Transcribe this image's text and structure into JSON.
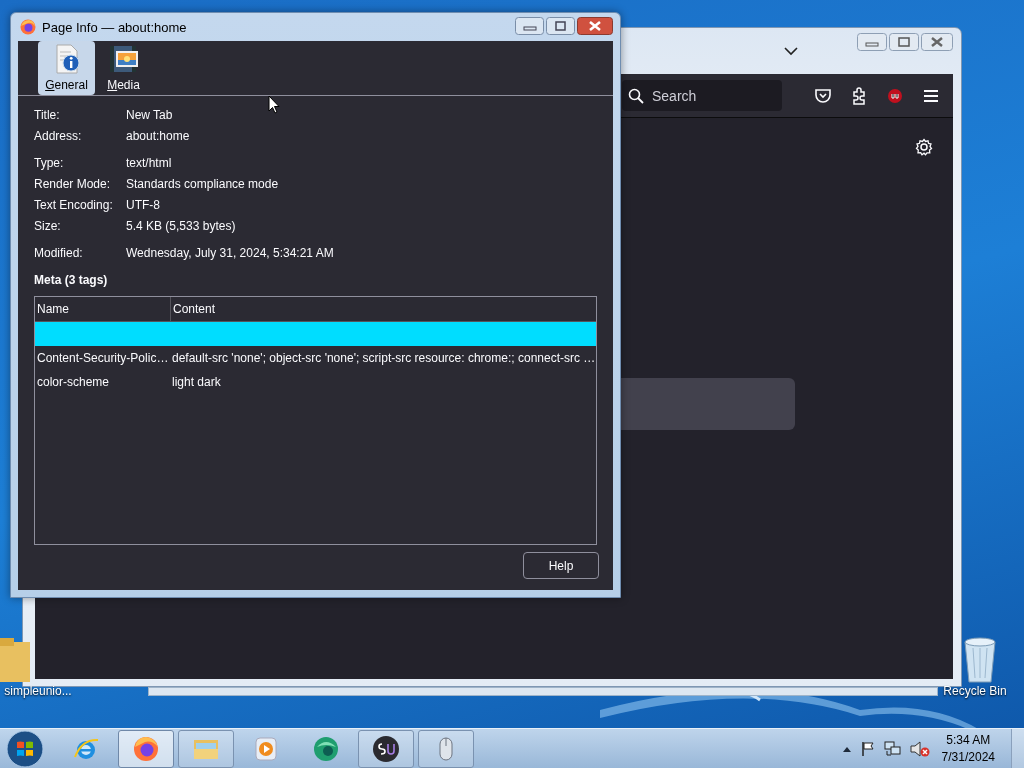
{
  "desktop": {
    "icons": [
      {
        "kind": "folder",
        "label": "simpleunio..."
      },
      {
        "kind": "recycle-bin",
        "label": "Recycle Bin"
      }
    ]
  },
  "browser": {
    "search": {
      "placeholder": "Search"
    }
  },
  "dialog": {
    "title": "Page Info — about:home",
    "tabs": [
      {
        "label": "General",
        "selected": true
      },
      {
        "label": "Media",
        "selected": false
      }
    ],
    "field_groups": [
      [
        {
          "label": "Title:",
          "value": "New Tab"
        },
        {
          "label": "Address:",
          "value": "about:home"
        }
      ],
      [
        {
          "label": "Type:",
          "value": "text/html"
        },
        {
          "label": "Render Mode:",
          "value": "Standards compliance mode"
        },
        {
          "label": "Text Encoding:",
          "value": "UTF-8"
        },
        {
          "label": "Size:",
          "value": "5.4 KB (5,533 bytes)"
        }
      ],
      [
        {
          "label": "Modified:",
          "value": "Wednesday, July 31, 2024, 5:34:21 AM"
        }
      ]
    ],
    "meta": {
      "heading": "Meta (3 tags)",
      "columns": [
        "Name",
        "Content"
      ],
      "rows": [
        {
          "selected": true
        },
        {
          "name": "Content-Security-Polic…",
          "content": "default-src 'none'; object-src 'none'; script-src resource: chrome:; connect-src …",
          "selected": false
        },
        {
          "name": "color-scheme",
          "content": "light dark",
          "selected": false
        }
      ]
    },
    "buttons": [
      "Help"
    ]
  },
  "taskbar": {
    "apps": [
      {
        "kind": "ie",
        "running": false,
        "selected": false
      },
      {
        "kind": "firefox",
        "running": true,
        "selected": true
      },
      {
        "kind": "explorer",
        "running": true,
        "selected": false
      },
      {
        "kind": "media",
        "running": false,
        "selected": false
      },
      {
        "kind": "green",
        "running": false,
        "selected": false
      },
      {
        "kind": "su",
        "running": true,
        "selected": false
      },
      {
        "kind": "mouse",
        "running": true,
        "selected": false
      }
    ],
    "muted": true,
    "time": "5:34 AM",
    "date": "7/31/2024"
  }
}
